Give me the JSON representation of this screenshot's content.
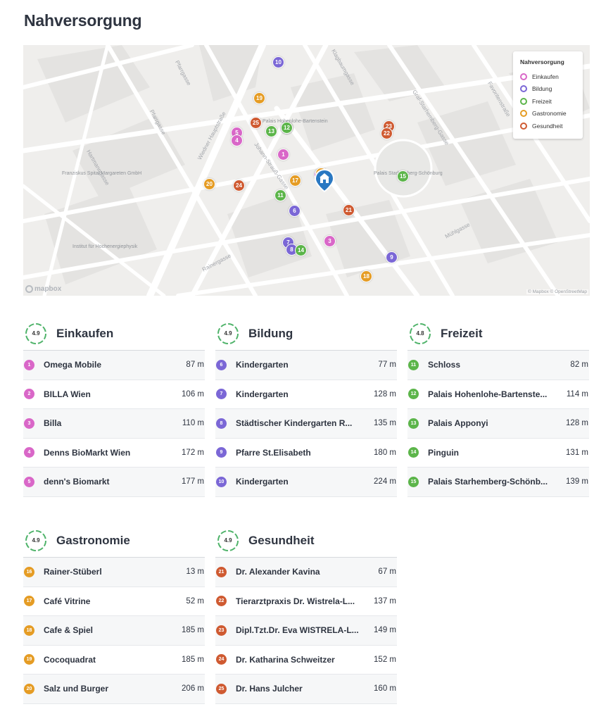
{
  "title": "Nahversorgung",
  "colors": {
    "einkaufen": "#d967c8",
    "bildung": "#7b67d6",
    "freizeit": "#5cb54a",
    "gastronomie": "#e59c24",
    "gesundheit": "#cf5a31",
    "home_pin": "#2a78c2"
  },
  "map": {
    "legend": {
      "title": "Nahversorgung",
      "items": [
        "Einkaufen",
        "Bildung",
        "Freizeit",
        "Gastronomie",
        "Gesundheit"
      ]
    },
    "street_labels": [
      "Pfarrgasse",
      "Pfarrgasse",
      "Hartmanngasse",
      "Wiedner Hauptstraße",
      "Johann-Strauß-Gasse",
      "Graf-Starhemberg-Gasse",
      "Favoritenstraße",
      "Rainergasse",
      "Klagbaumgasse",
      "Mühlgasse"
    ],
    "place_labels": [
      "Franziskus Spital Margareten GmbH",
      "Institut für Hochenergiephysik",
      "Palais Hohenlohe-Bartenstein",
      "Palais Starhemberg-Schönburg"
    ],
    "logo": "mapbox",
    "attribution": "© Mapbox © OpenStreetMap",
    "home_icon": "home-pin-icon"
  },
  "categories": [
    {
      "key": "einkaufen",
      "title": "Einkaufen",
      "score": "4.9",
      "items": [
        {
          "num": "1",
          "name": "Omega Mobile",
          "dist": "87 m"
        },
        {
          "num": "2",
          "name": "BILLA Wien",
          "dist": "106 m"
        },
        {
          "num": "3",
          "name": "Billa",
          "dist": "110 m"
        },
        {
          "num": "4",
          "name": "Denns BioMarkt Wien",
          "dist": "172 m"
        },
        {
          "num": "5",
          "name": "denn's Biomarkt",
          "dist": "177 m"
        }
      ]
    },
    {
      "key": "bildung",
      "title": "Bildung",
      "score": "4.9",
      "items": [
        {
          "num": "6",
          "name": "Kindergarten",
          "dist": "77 m"
        },
        {
          "num": "7",
          "name": "Kindergarten",
          "dist": "128 m"
        },
        {
          "num": "8",
          "name": "Städtischer Kindergarten R...",
          "dist": "135 m"
        },
        {
          "num": "9",
          "name": "Pfarre St.Elisabeth",
          "dist": "180 m"
        },
        {
          "num": "10",
          "name": "Kindergarten",
          "dist": "224 m"
        }
      ]
    },
    {
      "key": "freizeit",
      "title": "Freizeit",
      "score": "4.8",
      "items": [
        {
          "num": "11",
          "name": "Schloss",
          "dist": "82 m"
        },
        {
          "num": "12",
          "name": "Palais Hohenlohe-Bartenste...",
          "dist": "114 m"
        },
        {
          "num": "13",
          "name": "Palais Apponyi",
          "dist": "128 m"
        },
        {
          "num": "14",
          "name": "Pinguin",
          "dist": "131 m"
        },
        {
          "num": "15",
          "name": "Palais Starhemberg-Schönb...",
          "dist": "139 m"
        }
      ]
    },
    {
      "key": "gastronomie",
      "title": "Gastronomie",
      "score": "4.9",
      "items": [
        {
          "num": "16",
          "name": "Rainer-Stüberl",
          "dist": "13 m"
        },
        {
          "num": "17",
          "name": "Café Vitrine",
          "dist": "52 m"
        },
        {
          "num": "18",
          "name": "Cafe & Spiel",
          "dist": "185 m"
        },
        {
          "num": "19",
          "name": "Cocoquadrat",
          "dist": "185 m"
        },
        {
          "num": "20",
          "name": "Salz und Burger",
          "dist": "206 m"
        }
      ]
    },
    {
      "key": "gesundheit",
      "title": "Gesundheit",
      "score": "4.9",
      "items": [
        {
          "num": "21",
          "name": "Dr. Alexander Kavina",
          "dist": "67 m"
        },
        {
          "num": "22",
          "name": "Tierarztpraxis Dr. Wistrela-L...",
          "dist": "137 m"
        },
        {
          "num": "23",
          "name": "Dipl.Tzt.Dr. Eva WISTRELA-L...",
          "dist": "149 m"
        },
        {
          "num": "24",
          "name": "Dr. Katharina Schweitzer",
          "dist": "152 m"
        },
        {
          "num": "25",
          "name": "Dr. Hans Julcher",
          "dist": "160 m"
        }
      ]
    }
  ]
}
